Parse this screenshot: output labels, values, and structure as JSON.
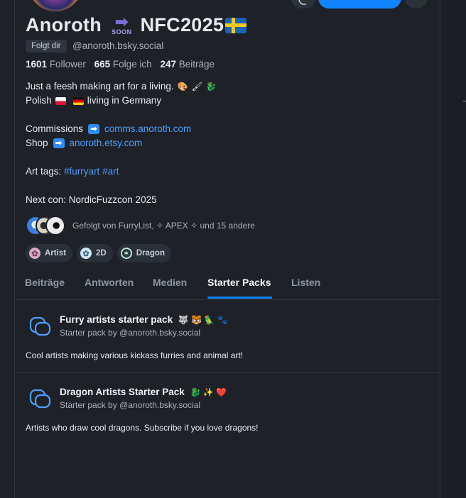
{
  "profile": {
    "name": "Anoroth",
    "soon_label": "SOON",
    "name_suffix": "NFC2025",
    "follows_you": "Folgt dir",
    "handle": "@anoroth.bsky.social",
    "followers_count": "1601",
    "followers_label": "Follower",
    "following_count": "665",
    "following_label": "Folge ich",
    "posts_count": "247",
    "posts_label": "Beiträge"
  },
  "bio": {
    "line1": "Just a feesh making art for a living.",
    "line2_a": "Polish",
    "line2_b": "living in Germany",
    "commissions_label": "Commissions",
    "commissions_link": "comms.anoroth.com",
    "shop_label": "Shop",
    "shop_link": "anoroth.etsy.com",
    "tags_label": "Art tags:",
    "tag1": "#furryart",
    "tag2": "#art",
    "next_con": "Next con: NordicFuzzcon 2025"
  },
  "followed_by": "Gefolgt von FurryList, ✧ APEX ✧ und 15 andere",
  "labels": [
    {
      "icon": "palette-icon",
      "text": "Artist"
    },
    {
      "icon": "dna-icon",
      "text": "2D"
    },
    {
      "icon": "dragon-icon",
      "text": "Dragon"
    }
  ],
  "tabs": [
    "Beiträge",
    "Antworten",
    "Medien",
    "Starter Packs",
    "Listen"
  ],
  "active_tab": "Starter Packs",
  "starter_packs": [
    {
      "title": "Furry artists starter pack",
      "emojis": "🐺 🐯 🦜 🐾",
      "subtitle": "Starter pack by @anoroth.bsky.social",
      "description": "Cool artists making various kickass furries and animal art!"
    },
    {
      "title": "Dragon Artists Starter Pack",
      "emojis": "🐉 ✨ ❤️",
      "subtitle": "Starter pack by @anoroth.bsky.social",
      "description": "Artists who draw cool dragons. Subscribe if you love dragons!"
    }
  ],
  "colors": {
    "accent": "#1083fe",
    "link": "#4f9dfd",
    "background": "#1e2228"
  }
}
